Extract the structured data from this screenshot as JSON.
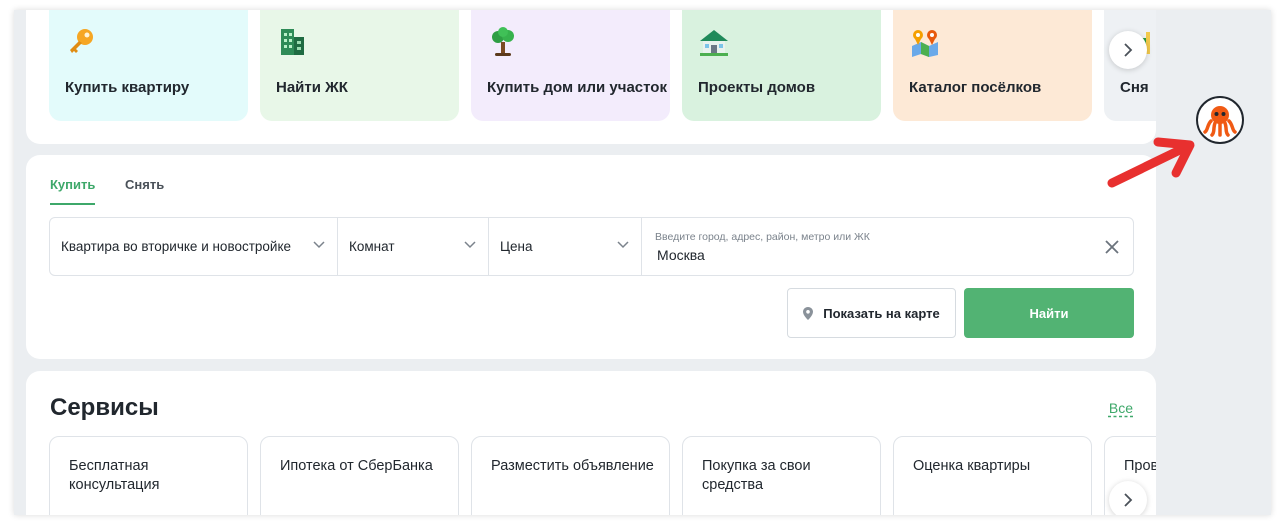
{
  "categories": [
    {
      "label": "Купить квартиру",
      "icon": "key-icon",
      "bg": "#e3fbfb"
    },
    {
      "label": "Найти ЖК",
      "icon": "building-icon",
      "bg": "#e8f7e8"
    },
    {
      "label": "Купить дом или участок",
      "icon": "tree-icon",
      "bg": "#f3ecfc"
    },
    {
      "label": "Проекты домов",
      "icon": "house-icon",
      "bg": "#d9f2df"
    },
    {
      "label": "Каталог посёлков",
      "icon": "map-pins-icon",
      "bg": "#fde9d6"
    },
    {
      "label": "Сня",
      "icon": "rent-icon",
      "bg": "#eef1f4"
    }
  ],
  "search": {
    "tabs": [
      "Купить",
      "Снять"
    ],
    "type_value": "Квартира во вторичке и новостройке",
    "rooms_value": "Комнат",
    "price_value": "Цена",
    "location_placeholder": "Введите город, адрес, район, метро или ЖК",
    "location_value": "Москва",
    "map_button": "Показать на карте",
    "find_button": "Найти"
  },
  "services": {
    "title": "Сервисы",
    "all_link": "Все",
    "items": [
      "Бесплатная консультация",
      "Ипотека от СберБанка",
      "Разместить объявление",
      "Покупка за свои средства",
      "Оценка квартиры",
      "Провер юрист"
    ]
  },
  "colors": {
    "accent": "#52b373",
    "accent_text": "#3ea86a",
    "annotation_arrow": "#e8302f"
  }
}
